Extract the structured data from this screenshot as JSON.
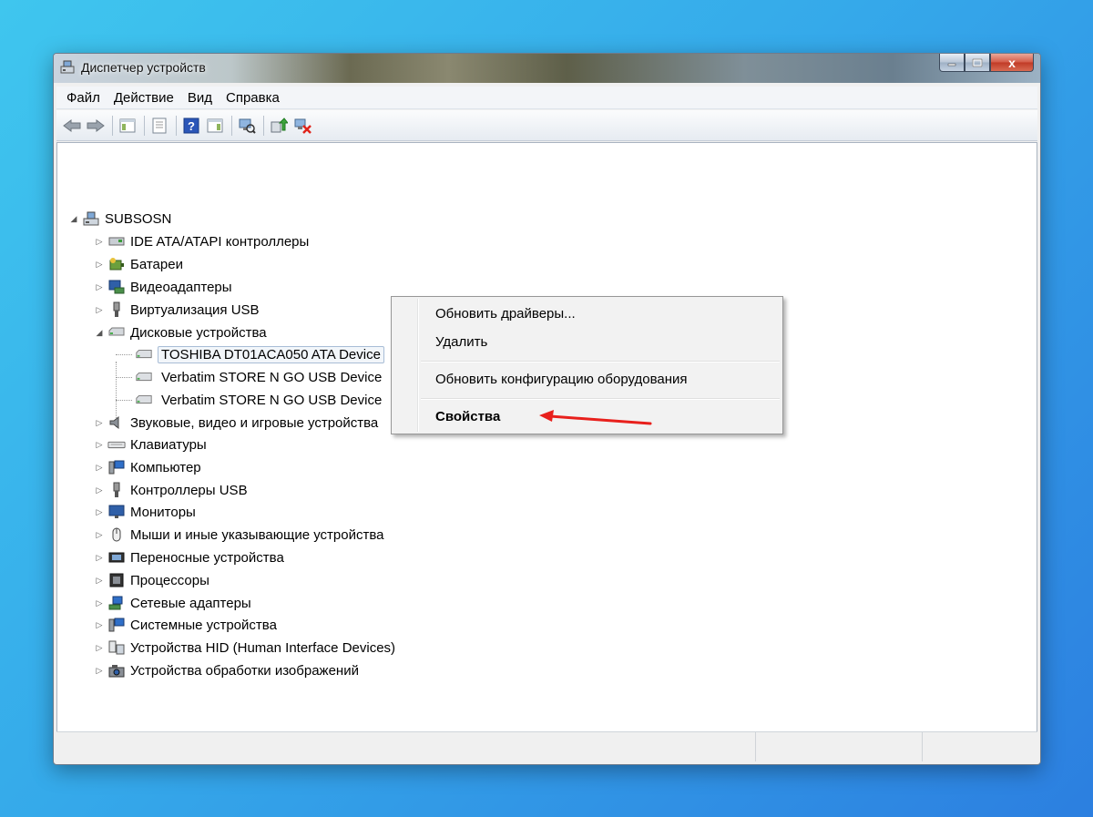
{
  "window": {
    "title": "Диспетчер устройств",
    "close_glyph": "x"
  },
  "menu": [
    "Файл",
    "Действие",
    "Вид",
    "Справка"
  ],
  "toolbar_icons": [
    "back-icon",
    "forward-icon",
    "show-hide-console-tree-icon",
    "properties-icon",
    "help-icon",
    "action-pane-icon",
    "scan-hardware-icon",
    "update-driver-icon",
    "uninstall-icon"
  ],
  "tree": {
    "root": "SUBSOSN",
    "categories": [
      {
        "label": "IDE ATA/ATAPI контроллеры",
        "icon": "ide-controller-icon",
        "expanded": false
      },
      {
        "label": "Батареи",
        "icon": "battery-icon",
        "expanded": false
      },
      {
        "label": "Видеоадаптеры",
        "icon": "display-adapter-icon",
        "expanded": false
      },
      {
        "label": "Виртуализация USB",
        "icon": "usb-icon",
        "expanded": false
      },
      {
        "label": "Дисковые устройства",
        "icon": "disk-drive-icon",
        "expanded": true
      },
      {
        "label": "Звуковые, видео и игровые устройства",
        "icon": "speaker-icon",
        "expanded": false
      },
      {
        "label": "Клавиатуры",
        "icon": "keyboard-icon",
        "expanded": false
      },
      {
        "label": "Компьютер",
        "icon": "computer-icon",
        "expanded": false
      },
      {
        "label": "Контроллеры USB",
        "icon": "usb-icon",
        "expanded": false
      },
      {
        "label": "Мониторы",
        "icon": "monitor-icon",
        "expanded": false
      },
      {
        "label": "Мыши и иные указывающие устройства",
        "icon": "mouse-icon",
        "expanded": false
      },
      {
        "label": "Переносные устройства",
        "icon": "portable-device-icon",
        "expanded": false
      },
      {
        "label": "Процессоры",
        "icon": "processor-icon",
        "expanded": false
      },
      {
        "label": "Сетевые адаптеры",
        "icon": "network-adapter-icon",
        "expanded": false
      },
      {
        "label": "Системные устройства",
        "icon": "system-device-icon",
        "expanded": false
      },
      {
        "label": "Устройства HID (Human Interface Devices)",
        "icon": "hid-icon",
        "expanded": false
      },
      {
        "label": "Устройства обработки изображений",
        "icon": "imaging-device-icon",
        "expanded": false
      }
    ],
    "disk_children": [
      {
        "label": "TOSHIBA DT01ACA050 ATA Device",
        "selected": true
      },
      {
        "label": "Verbatim STORE N GO USB Device",
        "selected": false
      },
      {
        "label": "Verbatim STORE N GO USB Device",
        "selected": false
      }
    ]
  },
  "context_menu": {
    "items": [
      {
        "label": "Обновить драйверы..."
      },
      {
        "label": "Удалить"
      },
      {
        "label": "Обновить конфигурацию оборудования"
      },
      {
        "label": "Свойства"
      }
    ]
  },
  "colors": {
    "annotation_arrow": "#e8201c",
    "selection_border": "#a8bdd6"
  }
}
